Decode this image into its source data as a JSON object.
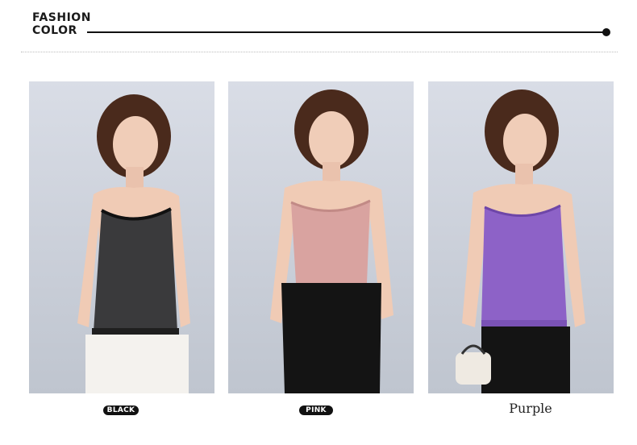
{
  "header": {
    "title_line1": "FASHION",
    "title_line2": "COLOR"
  },
  "products": [
    {
      "label": "BLACK",
      "top_color": "#3a3a3c",
      "bottom_color": "#f4f2ee"
    },
    {
      "label": "PINK",
      "top_color": "#d9a3a0",
      "bottom_color": "#141414"
    },
    {
      "label": "Purple",
      "top_color": "#8d62c7",
      "bottom_color": "#141414"
    }
  ]
}
